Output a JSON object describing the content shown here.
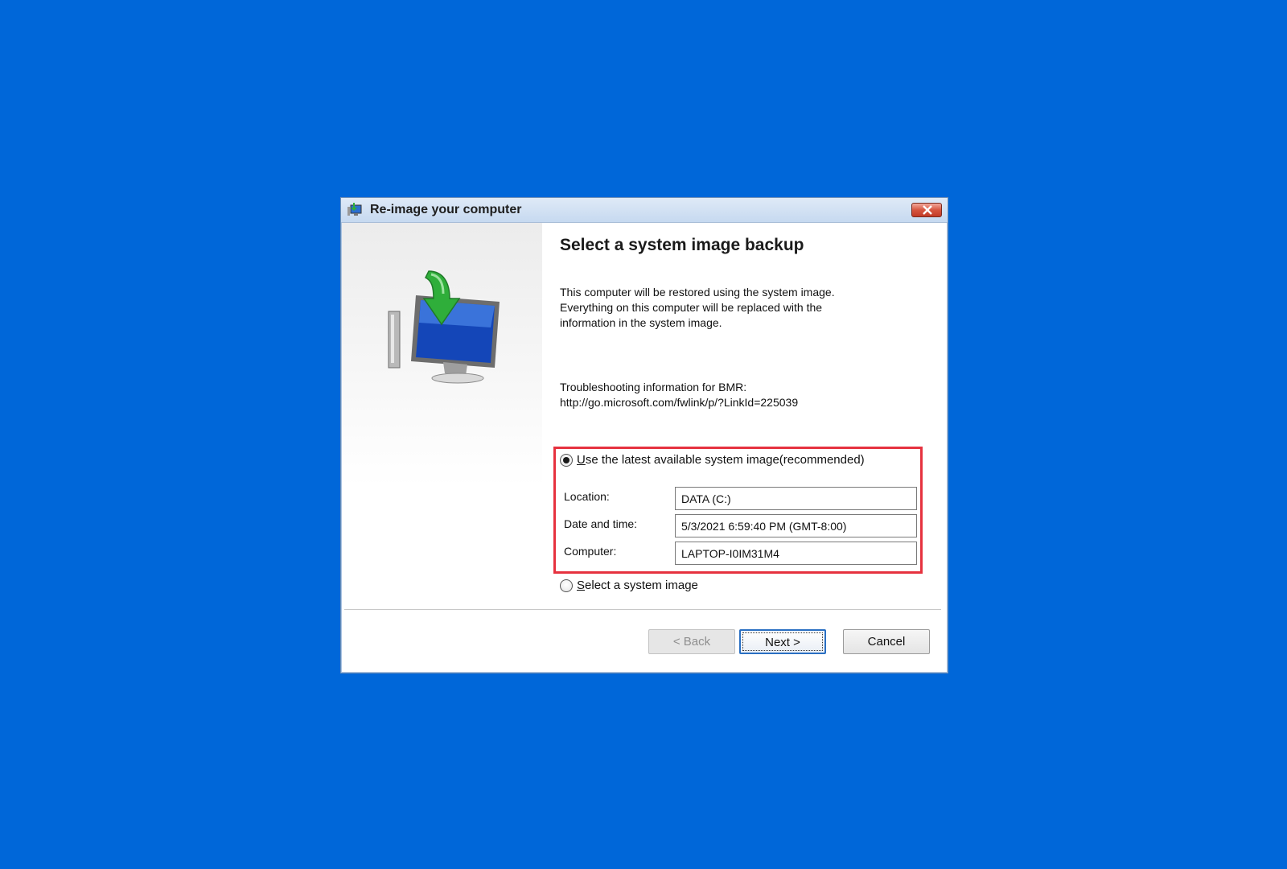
{
  "window": {
    "title": "Re-image your computer"
  },
  "main": {
    "heading": "Select a system image backup",
    "intro_lines": [
      "This computer will be restored using the system image.",
      "Everything on this computer will be replaced with the",
      "information in the system image."
    ],
    "troubleshoot_label": "Troubleshooting information for BMR:",
    "troubleshoot_link": "http://go.microsoft.com/fwlink/p/?LinkId=225039"
  },
  "options": {
    "latest": {
      "label_mnemonic": "U",
      "label_rest": "se the latest available system image(recommended)",
      "selected": true
    },
    "select": {
      "label_mnemonic": "S",
      "label_rest": "elect a system image",
      "selected": false
    }
  },
  "details": {
    "location_label": "Location:",
    "location_value": "DATA (C:)",
    "datetime_label": "Date and time:",
    "datetime_value": "5/3/2021 6:59:40 PM (GMT-8:00)",
    "computer_label": "Computer:",
    "computer_value": "LAPTOP-I0IM31M4"
  },
  "buttons": {
    "back": "< Back",
    "next": "Next >",
    "cancel": "Cancel"
  },
  "icons": {
    "app": "backup-restore-icon",
    "close": "close-icon",
    "wizard": "computer-restore-illustration"
  },
  "colors": {
    "desktop": "#0067d9",
    "highlight": "#e6323f",
    "close_button": "#c23a26"
  }
}
